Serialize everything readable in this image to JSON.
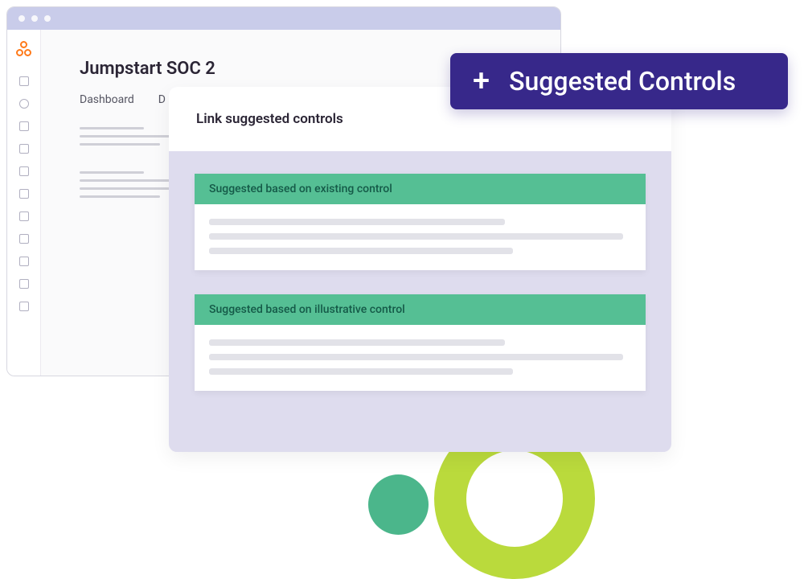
{
  "back_window": {
    "title": "Jumpstart SOC 2",
    "tabs": [
      "Dashboard",
      "D"
    ]
  },
  "front_window": {
    "header": "Link suggested controls",
    "cards": [
      {
        "title": "Suggested based on existing control"
      },
      {
        "title": "Suggested based on illustrative control"
      }
    ]
  },
  "suggested_button": {
    "plus": "+",
    "label": "Suggested Controls"
  },
  "colors": {
    "purple": "#37288a",
    "green": "#55bf94",
    "lime": "#bada3c",
    "orange": "#ff7a1a"
  }
}
